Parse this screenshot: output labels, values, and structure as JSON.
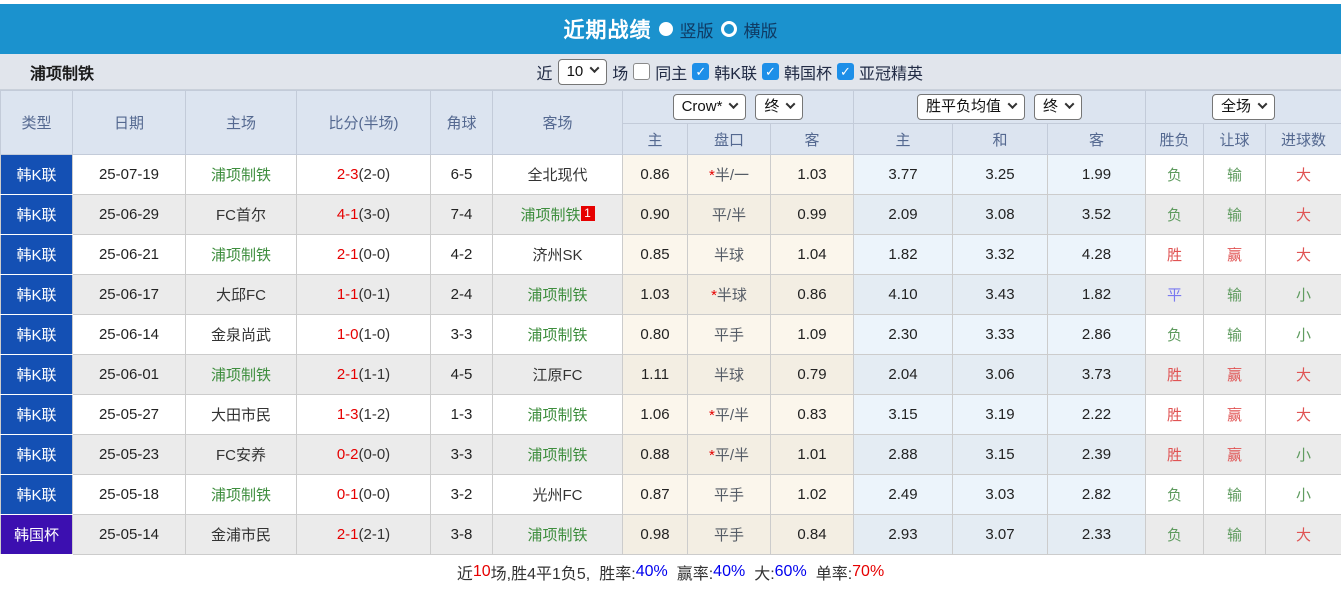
{
  "titlebar": {
    "title": "近期战绩",
    "vertical_label": "竖版",
    "horizontal_label": "横版"
  },
  "filterbar": {
    "team": "浦项制铁",
    "near": "近",
    "count": "10",
    "games": "场",
    "same_home": "同主",
    "league1": "韩K联",
    "league2": "韩国杯",
    "league3": "亚冠精英"
  },
  "icons": {
    "checkbox_check": "✓"
  },
  "colors": {
    "header_bar": "#1b92ce",
    "league_type": "#1450b4",
    "cup_type": "#3c0fb0",
    "self_team_green": "#3e8e3e",
    "score_red": "#e60000",
    "win_red": "#e05353",
    "lose_green": "#5f9b5f",
    "draw_blue": "#7a7af0",
    "stat_blue": "#0000ee"
  },
  "header": {
    "type": "类型",
    "date": "日期",
    "home": "主场",
    "score": "比分(半场)",
    "corner": "角球",
    "away": "客场",
    "odds_source": "Crow*",
    "odds_time": "终",
    "odds_home": "主",
    "odds_pan": "盘口",
    "odds_away": "客",
    "avg_source": "胜平负均值",
    "avg_time": "终",
    "avg_home": "主",
    "avg_draw": "和",
    "avg_away": "客",
    "result_scope": "全场",
    "wdl": "胜负",
    "handicap": "让球",
    "goals": "进球数"
  },
  "rows": [
    {
      "type": {
        "text": "韩K联",
        "cls": "type-cell league"
      },
      "date": "25-07-19",
      "home": {
        "text": "浦项制铁",
        "cls": "team self"
      },
      "score": {
        "main": "2-3",
        "half": "(2-0)"
      },
      "corner": "6-5",
      "away": {
        "text": "全北现代",
        "cls": "team",
        "badge": ""
      },
      "odds": {
        "home": "0.86",
        "star": "*",
        "pan": "半/一",
        "away": "1.03"
      },
      "avg": {
        "home": "3.77",
        "draw": "3.25",
        "away": "1.99"
      },
      "res": {
        "wdl": {
          "text": "负",
          "cls": "res green"
        },
        "let": {
          "text": "输",
          "cls": "res green"
        },
        "goal": {
          "text": "大",
          "cls": "res red"
        }
      }
    },
    {
      "type": {
        "text": "韩K联",
        "cls": "type-cell league"
      },
      "date": "25-06-29",
      "home": {
        "text": "FC首尔",
        "cls": "team"
      },
      "score": {
        "main": "4-1",
        "half": "(3-0)"
      },
      "corner": "7-4",
      "away": {
        "text": "浦项制铁",
        "cls": "team self",
        "badge": "1"
      },
      "odds": {
        "home": "0.90",
        "star": "",
        "pan": "平/半",
        "away": "0.99"
      },
      "avg": {
        "home": "2.09",
        "draw": "3.08",
        "away": "3.52"
      },
      "res": {
        "wdl": {
          "text": "负",
          "cls": "res green"
        },
        "let": {
          "text": "输",
          "cls": "res green"
        },
        "goal": {
          "text": "大",
          "cls": "res red"
        }
      }
    },
    {
      "type": {
        "text": "韩K联",
        "cls": "type-cell league"
      },
      "date": "25-06-21",
      "home": {
        "text": "浦项制铁",
        "cls": "team self"
      },
      "score": {
        "main": "2-1",
        "half": "(0-0)"
      },
      "corner": "4-2",
      "away": {
        "text": "济州SK",
        "cls": "team",
        "badge": ""
      },
      "odds": {
        "home": "0.85",
        "star": "",
        "pan": "半球",
        "away": "1.04"
      },
      "avg": {
        "home": "1.82",
        "draw": "3.32",
        "away": "4.28"
      },
      "res": {
        "wdl": {
          "text": "胜",
          "cls": "res red"
        },
        "let": {
          "text": "赢",
          "cls": "res red"
        },
        "goal": {
          "text": "大",
          "cls": "res red"
        }
      }
    },
    {
      "type": {
        "text": "韩K联",
        "cls": "type-cell league"
      },
      "date": "25-06-17",
      "home": {
        "text": "大邱FC",
        "cls": "team"
      },
      "score": {
        "main": "1-1",
        "half": "(0-1)"
      },
      "corner": "2-4",
      "away": {
        "text": "浦项制铁",
        "cls": "team self",
        "badge": ""
      },
      "odds": {
        "home": "1.03",
        "star": "*",
        "pan": "半球",
        "away": "0.86"
      },
      "avg": {
        "home": "4.10",
        "draw": "3.43",
        "away": "1.82"
      },
      "res": {
        "wdl": {
          "text": "平",
          "cls": "res blue"
        },
        "let": {
          "text": "输",
          "cls": "res green"
        },
        "goal": {
          "text": "小",
          "cls": "res green"
        }
      }
    },
    {
      "type": {
        "text": "韩K联",
        "cls": "type-cell league"
      },
      "date": "25-06-14",
      "home": {
        "text": "金泉尚武",
        "cls": "team"
      },
      "score": {
        "main": "1-0",
        "half": "(1-0)"
      },
      "corner": "3-3",
      "away": {
        "text": "浦项制铁",
        "cls": "team self",
        "badge": ""
      },
      "odds": {
        "home": "0.80",
        "star": "",
        "pan": "平手",
        "away": "1.09"
      },
      "avg": {
        "home": "2.30",
        "draw": "3.33",
        "away": "2.86"
      },
      "res": {
        "wdl": {
          "text": "负",
          "cls": "res green"
        },
        "let": {
          "text": "输",
          "cls": "res green"
        },
        "goal": {
          "text": "小",
          "cls": "res green"
        }
      }
    },
    {
      "type": {
        "text": "韩K联",
        "cls": "type-cell league"
      },
      "date": "25-06-01",
      "home": {
        "text": "浦项制铁",
        "cls": "team self"
      },
      "score": {
        "main": "2-1",
        "half": "(1-1)"
      },
      "corner": "4-5",
      "away": {
        "text": "江原FC",
        "cls": "team",
        "badge": ""
      },
      "odds": {
        "home": "1.11",
        "star": "",
        "pan": "半球",
        "away": "0.79"
      },
      "avg": {
        "home": "2.04",
        "draw": "3.06",
        "away": "3.73"
      },
      "res": {
        "wdl": {
          "text": "胜",
          "cls": "res red"
        },
        "let": {
          "text": "赢",
          "cls": "res red"
        },
        "goal": {
          "text": "大",
          "cls": "res red"
        }
      }
    },
    {
      "type": {
        "text": "韩K联",
        "cls": "type-cell league"
      },
      "date": "25-05-27",
      "home": {
        "text": "大田市民",
        "cls": "team"
      },
      "score": {
        "main": "1-3",
        "half": "(1-2)"
      },
      "corner": "1-3",
      "away": {
        "text": "浦项制铁",
        "cls": "team self",
        "badge": ""
      },
      "odds": {
        "home": "1.06",
        "star": "*",
        "pan": "平/半",
        "away": "0.83"
      },
      "avg": {
        "home": "3.15",
        "draw": "3.19",
        "away": "2.22"
      },
      "res": {
        "wdl": {
          "text": "胜",
          "cls": "res red"
        },
        "let": {
          "text": "赢",
          "cls": "res red"
        },
        "goal": {
          "text": "大",
          "cls": "res red"
        }
      }
    },
    {
      "type": {
        "text": "韩K联",
        "cls": "type-cell league"
      },
      "date": "25-05-23",
      "home": {
        "text": "FC安养",
        "cls": "team"
      },
      "score": {
        "main": "0-2",
        "half": "(0-0)"
      },
      "corner": "3-3",
      "away": {
        "text": "浦项制铁",
        "cls": "team self",
        "badge": ""
      },
      "odds": {
        "home": "0.88",
        "star": "*",
        "pan": "平/半",
        "away": "1.01"
      },
      "avg": {
        "home": "2.88",
        "draw": "3.15",
        "away": "2.39"
      },
      "res": {
        "wdl": {
          "text": "胜",
          "cls": "res red"
        },
        "let": {
          "text": "赢",
          "cls": "res red"
        },
        "goal": {
          "text": "小",
          "cls": "res green"
        }
      }
    },
    {
      "type": {
        "text": "韩K联",
        "cls": "type-cell league"
      },
      "date": "25-05-18",
      "home": {
        "text": "浦项制铁",
        "cls": "team self"
      },
      "score": {
        "main": "0-1",
        "half": "(0-0)"
      },
      "corner": "3-2",
      "away": {
        "text": "光州FC",
        "cls": "team",
        "badge": ""
      },
      "odds": {
        "home": "0.87",
        "star": "",
        "pan": "平手",
        "away": "1.02"
      },
      "avg": {
        "home": "2.49",
        "draw": "3.03",
        "away": "2.82"
      },
      "res": {
        "wdl": {
          "text": "负",
          "cls": "res green"
        },
        "let": {
          "text": "输",
          "cls": "res green"
        },
        "goal": {
          "text": "小",
          "cls": "res green"
        }
      }
    },
    {
      "type": {
        "text": "韩国杯",
        "cls": "type-cell cup"
      },
      "date": "25-05-14",
      "home": {
        "text": "金浦市民",
        "cls": "team"
      },
      "score": {
        "main": "2-1",
        "half": "(2-1)"
      },
      "corner": "3-8",
      "away": {
        "text": "浦项制铁",
        "cls": "team self",
        "badge": ""
      },
      "odds": {
        "home": "0.98",
        "star": "",
        "pan": "平手",
        "away": "0.84"
      },
      "avg": {
        "home": "2.93",
        "draw": "3.07",
        "away": "2.33"
      },
      "res": {
        "wdl": {
          "text": "负",
          "cls": "res green"
        },
        "let": {
          "text": "输",
          "cls": "res green"
        },
        "goal": {
          "text": "大",
          "cls": "res red"
        }
      }
    }
  ],
  "summary": {
    "near": "近",
    "count": "10",
    "mid": "场,胜4平1负5,",
    "rate_label": "胜率:",
    "rate": "40%",
    "win_label": "赢率:",
    "win": "40%",
    "big_label": "大:",
    "big": "60%",
    "single_label": "单率:",
    "single": "70%"
  }
}
